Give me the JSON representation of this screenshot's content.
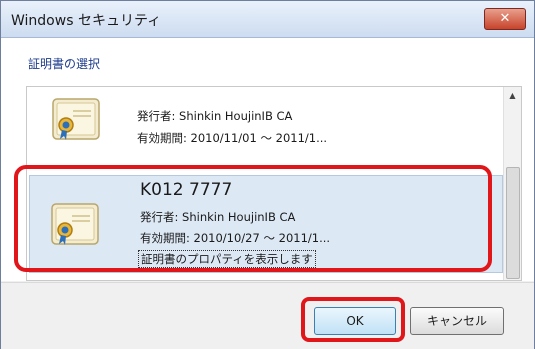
{
  "window": {
    "title": "Windows セキュリティ",
    "close_label": "✕"
  },
  "dialog": {
    "heading": "証明書の選択"
  },
  "certificates": [
    {
      "issuer": "発行者: Shinkin HoujinIB CA",
      "validity": "有効期間: 2010/11/01 ～ 2011/1..."
    },
    {
      "name": "K012  7777",
      "issuer": "発行者: Shinkin HoujinIB CA",
      "validity": "有効期間: 2010/10/27 ～ 2011/1...",
      "properties_link": "証明書のプロパティを表示します",
      "selected": true
    }
  ],
  "buttons": {
    "ok": "OK",
    "cancel": "キャンセル"
  },
  "icons": {
    "certificate": "certificate-icon",
    "scroll_up": "scroll-up-arrow-icon",
    "close": "close-icon"
  },
  "colors": {
    "highlight": "#e0161b",
    "title_bar": "#cddcf0",
    "selected_row": "#dde8f5",
    "heading": "#1e3c8c"
  }
}
